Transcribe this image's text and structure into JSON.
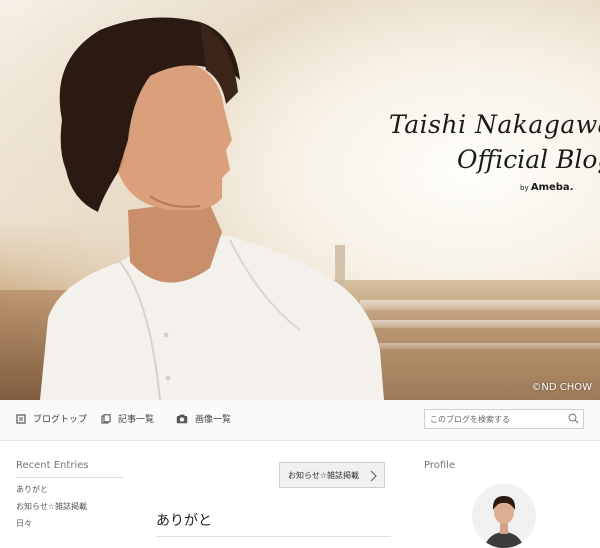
{
  "header": {
    "brand_line1": "Taishi Nakagawa",
    "brand_line2": "Official Blog",
    "brand_by": "by",
    "brand_service": "Ameba.",
    "photo_credit": "©ND CHOW"
  },
  "nav": {
    "items": [
      {
        "label": "ブログトップ",
        "icon": "home-icon"
      },
      {
        "label": "記事一覧",
        "icon": "list-icon"
      },
      {
        "label": "画像一覧",
        "icon": "camera-icon"
      }
    ],
    "search_placeholder": "このブログを検索する"
  },
  "sidebar": {
    "recent_title": "Recent Entries",
    "entries": [
      "ありがと",
      "お知らせ☆雑誌掲載",
      "日々"
    ]
  },
  "main": {
    "notice_label": "お知らせ☆雑誌掲載",
    "post_title": "ありがと"
  },
  "profile": {
    "title": "Profile"
  },
  "colors": {
    "nav_bg": "#fafafa",
    "text": "#333333",
    "muted": "#777777"
  }
}
